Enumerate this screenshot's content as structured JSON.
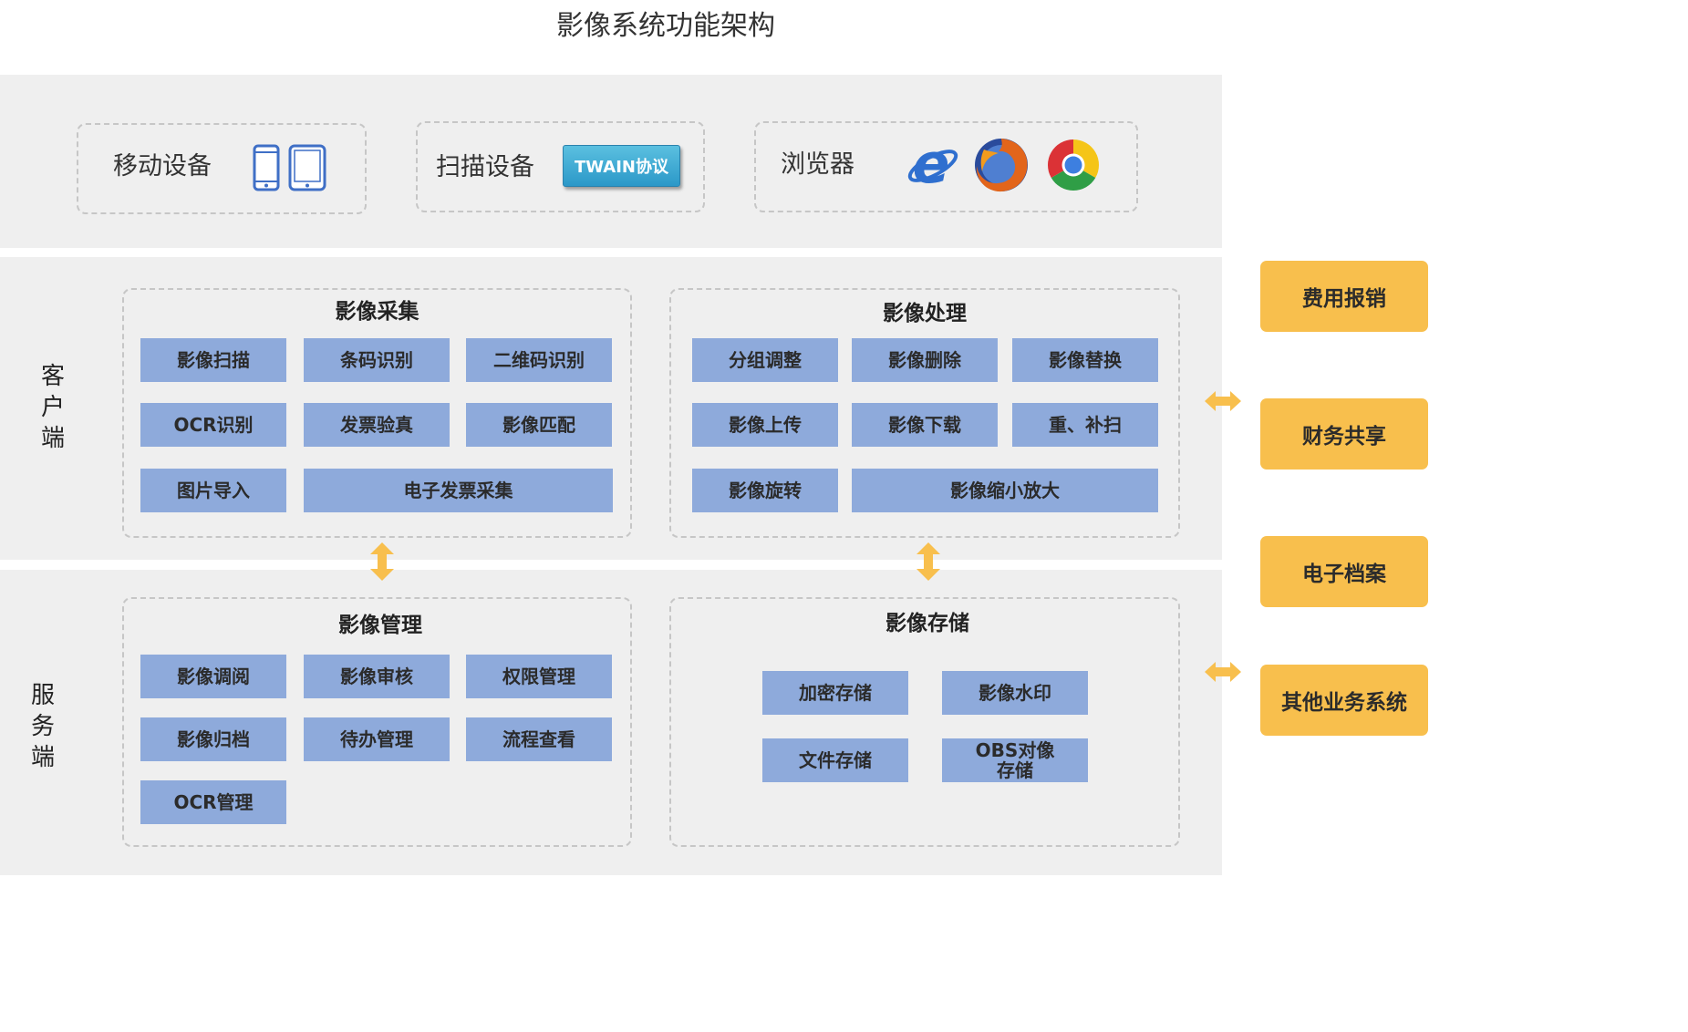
{
  "title": "影像系统功能架构",
  "devices": {
    "mobile_label": "移动设备",
    "scanner_label": "扫描设备",
    "twain_label": "TWAIN协议",
    "browser_label": "浏览器"
  },
  "client_label": [
    "客",
    "户",
    "端"
  ],
  "server_label": [
    "服",
    "务",
    "端"
  ],
  "panels": {
    "capture": {
      "title": "影像采集",
      "items": [
        "影像扫描",
        "条码识别",
        "二维码识别",
        "OCR识别",
        "发票验真",
        "影像匹配",
        "图片导入",
        "电子发票采集"
      ]
    },
    "processing": {
      "title": "影像处理",
      "items": [
        "分组调整",
        "影像删除",
        "影像替换",
        "影像上传",
        "影像下载",
        "重、补扫",
        "影像旋转",
        "影像缩小放大"
      ]
    },
    "management": {
      "title": "影像管理",
      "items": [
        "影像调阅",
        "影像审核",
        "权限管理",
        "影像归档",
        "待办管理",
        "流程查看",
        "OCR管理"
      ]
    },
    "storage": {
      "title": "影像存储",
      "items": [
        "加密存储",
        "影像水印",
        "文件存储",
        "OBS对像\n存储"
      ]
    }
  },
  "business_systems": [
    "费用报销",
    "财务共享",
    "电子档案",
    "其他业务系统"
  ],
  "colors": {
    "band_background": "#efefef",
    "tile_fill": "#8eaadb",
    "business_fill": "#f8bf4d",
    "arrow_fill": "#f8bf4d",
    "twain_fill": "#35a7d4"
  },
  "icons": [
    "phone-icon",
    "tablet-icon",
    "ie-icon",
    "firefox-icon",
    "chrome-icon",
    "double-arrow-icon"
  ]
}
